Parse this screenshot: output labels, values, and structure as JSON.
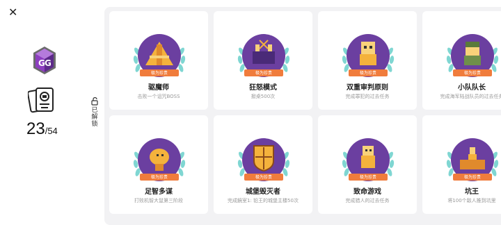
{
  "close_icon": "close-icon",
  "progress": {
    "unlocked": "23",
    "total": "/54"
  },
  "unlocked_label": "已解锁",
  "rarity_label": "极为珍贵",
  "colors": {
    "purple": "#6b3fa0",
    "orange": "#f07c3c",
    "laurel": "#7fd6d2"
  },
  "achievements": [
    {
      "name": "驱魔师",
      "desc": "击败一个诅咒BOSS",
      "icon": "exorcist-icon"
    },
    {
      "name": "狂怒模式",
      "desc": "掀桌500次",
      "icon": "rage-mode-icon"
    },
    {
      "name": "双重审判原则",
      "desc": "完成罪犯的过去任务",
      "icon": "double-trial-icon"
    },
    {
      "name": "小队队长",
      "desc": "完成海军陆战队员的过去任务",
      "icon": "squad-leader-icon"
    },
    {
      "name": "足智多谋",
      "desc": "打败机智大鼠第三阶段",
      "icon": "resourceful-icon"
    },
    {
      "name": "城堡毁灭者",
      "desc": "完成鏡室1: 铅王的城堡主楼50次",
      "icon": "castle-destroyer-icon"
    },
    {
      "name": "致命游戏",
      "desc": "完成猎人的过去任务",
      "icon": "deadly-game-icon"
    },
    {
      "name": "坑王",
      "desc": "将100个敌人推到坑里",
      "icon": "pit-king-icon"
    }
  ]
}
